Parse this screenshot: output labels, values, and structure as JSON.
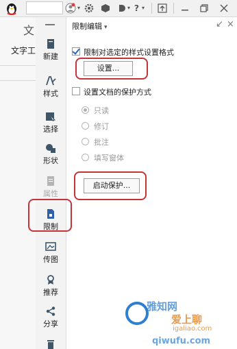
{
  "app": {
    "ribbon_label": "文字工",
    "ribbon_glyph": "文"
  },
  "topbar": {
    "icons": [
      "qq-penguin-icon",
      "avatar-icon",
      "settings-icon",
      "hexagon-icon",
      "undo-icon",
      "help-icon",
      "window-restore-icon",
      "minimize-icon",
      "restore-icon",
      "close-icon"
    ],
    "help_glyph": "?"
  },
  "sidebar": {
    "items": [
      {
        "label": "新建",
        "icon": "new-icon"
      },
      {
        "label": "样式",
        "icon": "styles-icon"
      },
      {
        "label": "选择",
        "icon": "select-icon"
      },
      {
        "label": "形状",
        "icon": "shapes-icon"
      },
      {
        "label": "属性",
        "icon": "properties-icon"
      },
      {
        "label": "限制",
        "icon": "restrict-icon"
      },
      {
        "label": "传图",
        "icon": "upload-image-icon"
      },
      {
        "label": "推荐",
        "icon": "recommend-icon"
      },
      {
        "label": "分享",
        "icon": "share-icon"
      }
    ]
  },
  "panel": {
    "title": "限制编辑",
    "title_caret": "▾",
    "restrict_format_label": "限制对选定的样式设置格式",
    "restrict_format_checked": true,
    "settings_button": "设置...",
    "protect_label": "设置文档的保护方式",
    "protect_checked": false,
    "options": [
      "只读",
      "修订",
      "批注",
      "填写窗体"
    ],
    "selected_option": "只读",
    "start_protect_button": "启动保护...",
    "pin_glyph": "↙",
    "close_glyph": "×"
  },
  "watermark": {
    "brand": "雅知网",
    "domain_cn": "爱上聊",
    "domain_text": "igaliao.com",
    "bottom_text": "qiwufu.com",
    "colors": {
      "blue": "#2f7fd0",
      "orange": "#e8892b"
    }
  },
  "colors": {
    "highlight": "#c4323a",
    "checkmark": "#2a63b8"
  }
}
